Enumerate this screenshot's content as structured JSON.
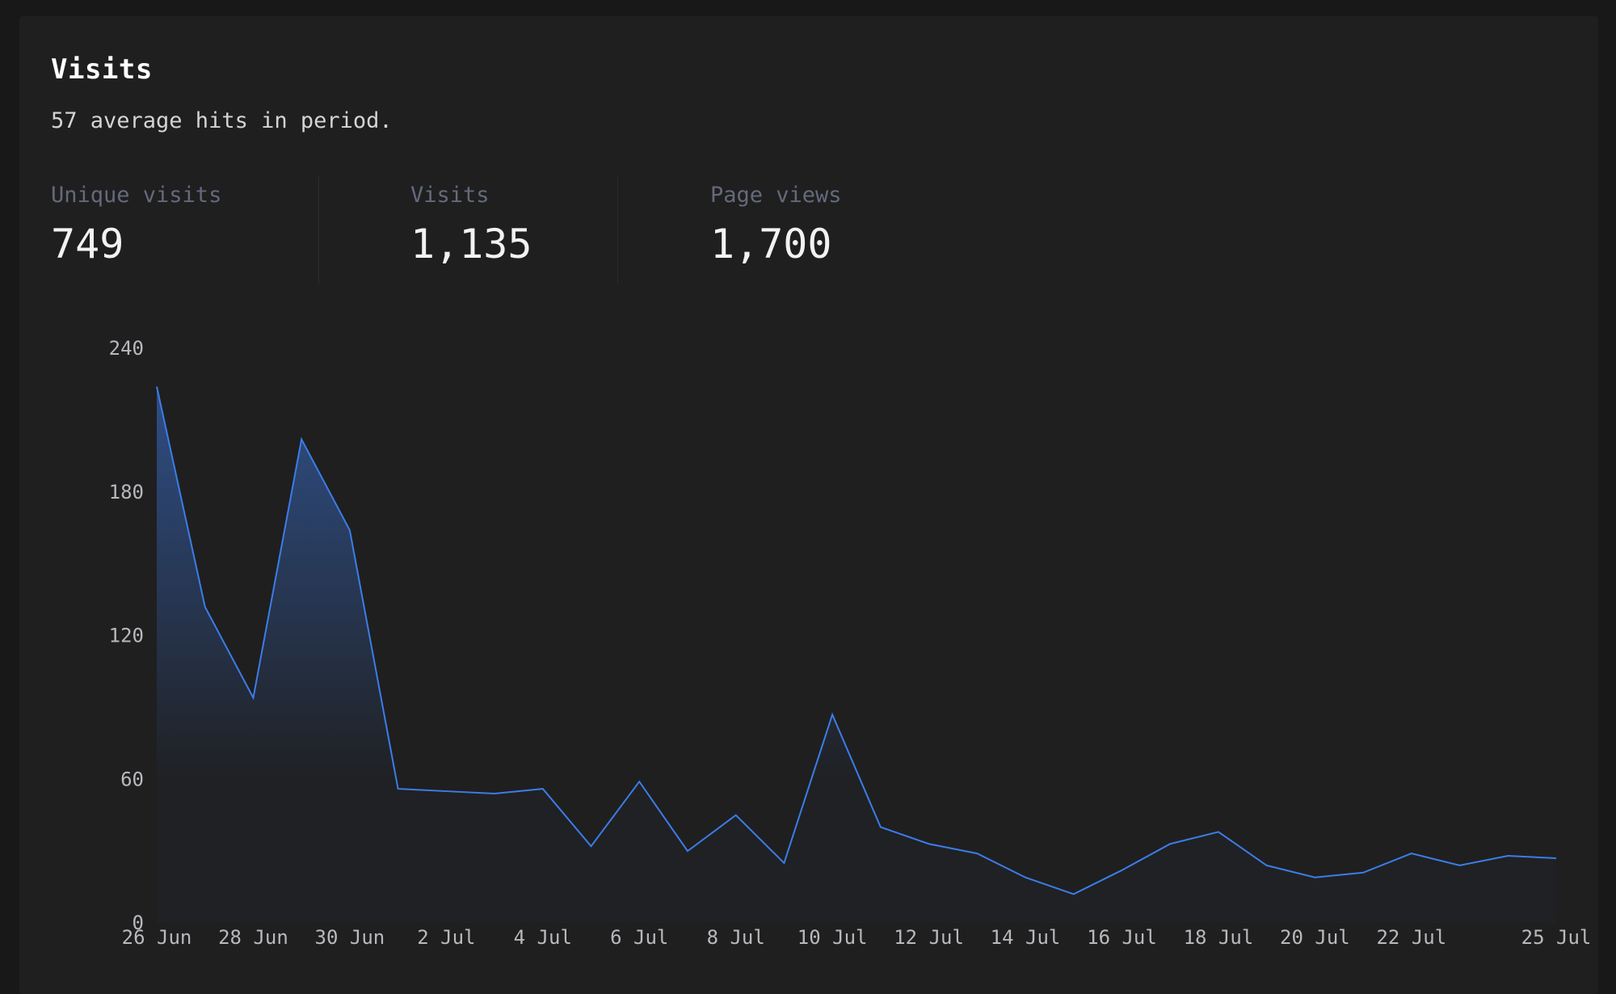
{
  "panel": {
    "title": "Visits",
    "subtitle": "57 average hits in period."
  },
  "stats": [
    {
      "label": "Unique visits",
      "value": "749"
    },
    {
      "label": "Visits",
      "value": "1,135"
    },
    {
      "label": "Page views",
      "value": "1,700"
    }
  ],
  "colors": {
    "line": "#3b7de8",
    "fill_top": "#2f4f87",
    "background": "#1f1f20"
  },
  "chart_data": {
    "type": "area",
    "title": "",
    "xlabel": "",
    "ylabel": "",
    "ylim": [
      0,
      240
    ],
    "y_ticks": [
      0,
      60,
      120,
      180,
      240
    ],
    "grid": false,
    "legend": "none",
    "x": [
      "26 Jun",
      "27 Jun",
      "28 Jun",
      "29 Jun",
      "30 Jun",
      "1 Jul",
      "2 Jul",
      "3 Jul",
      "4 Jul",
      "5 Jul",
      "6 Jul",
      "7 Jul",
      "8 Jul",
      "9 Jul",
      "10 Jul",
      "11 Jul",
      "12 Jul",
      "13 Jul",
      "14 Jul",
      "15 Jul",
      "16 Jul",
      "17 Jul",
      "18 Jul",
      "19 Jul",
      "20 Jul",
      "21 Jul",
      "22 Jul",
      "23 Jul",
      "24 Jul",
      "25 Jul"
    ],
    "x_tick_labels": [
      {
        "index": 0,
        "label": "26 Jun"
      },
      {
        "index": 2,
        "label": "28 Jun"
      },
      {
        "index": 4,
        "label": "30 Jun"
      },
      {
        "index": 6,
        "label": "2 Jul"
      },
      {
        "index": 8,
        "label": "4 Jul"
      },
      {
        "index": 10,
        "label": "6 Jul"
      },
      {
        "index": 12,
        "label": "8 Jul"
      },
      {
        "index": 14,
        "label": "10 Jul"
      },
      {
        "index": 16,
        "label": "12 Jul"
      },
      {
        "index": 18,
        "label": "14 Jul"
      },
      {
        "index": 20,
        "label": "16 Jul"
      },
      {
        "index": 22,
        "label": "18 Jul"
      },
      {
        "index": 24,
        "label": "20 Jul"
      },
      {
        "index": 26,
        "label": "22 Jul"
      },
      {
        "index": 29,
        "label": "25 Jul"
      }
    ],
    "series": [
      {
        "values": [
          224,
          132,
          94,
          202,
          164,
          56,
          55,
          54,
          56,
          32,
          59,
          30,
          45,
          25,
          87,
          40,
          33,
          29,
          19,
          12,
          22,
          33,
          38,
          24,
          19,
          21,
          29,
          24,
          28,
          27
        ]
      }
    ]
  }
}
